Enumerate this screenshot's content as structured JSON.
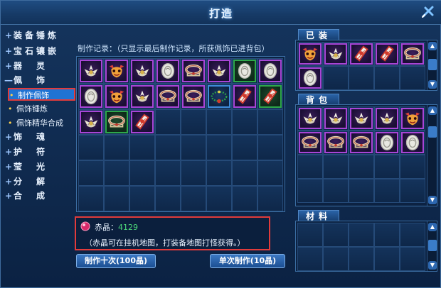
{
  "window": {
    "title": "打造"
  },
  "sidebar": {
    "items": [
      {
        "glyph": "+",
        "label": "装备锤炼"
      },
      {
        "glyph": "+",
        "label": "宝石镶嵌"
      },
      {
        "glyph": "+",
        "label": "器　灵"
      },
      {
        "glyph": "—",
        "label": "佩　饰"
      },
      {
        "glyph": "+",
        "label": "饰　魂"
      },
      {
        "glyph": "+",
        "label": "护　符"
      },
      {
        "glyph": "+",
        "label": "莹　光"
      },
      {
        "glyph": "+",
        "label": "分　解"
      },
      {
        "glyph": "+",
        "label": "合　成"
      }
    ],
    "subitems": [
      {
        "label": "制作佩饰",
        "active": true
      },
      {
        "label": "佩饰锤炼",
        "active": false
      },
      {
        "label": "佩饰精华合成",
        "active": false
      }
    ]
  },
  "record": {
    "label": "制作记录：（只显示最后制作记录，所获佩饰已进背包）"
  },
  "record_items": [
    {
      "icon": "lotus-ornament",
      "border": "purple"
    },
    {
      "icon": "demon-mask",
      "border": "purple"
    },
    {
      "icon": "lotus-ornament",
      "border": "purple"
    },
    {
      "icon": "jade-pendant",
      "border": "purple"
    },
    {
      "icon": "bracelet",
      "border": "purple"
    },
    {
      "icon": "lotus-ornament",
      "border": "purple"
    },
    {
      "icon": "jade-pendant",
      "border": "green"
    },
    {
      "icon": "jade-pendant",
      "border": "purple"
    },
    {
      "icon": "jade-pendant",
      "border": "purple"
    },
    {
      "icon": "demon-mask",
      "border": "purple"
    },
    {
      "icon": "lotus-ornament",
      "border": "purple"
    },
    {
      "icon": "bracelet",
      "border": "purple"
    },
    {
      "icon": "bracelet",
      "border": "purple"
    },
    {
      "icon": "beaded-necklace",
      "border": "blue"
    },
    {
      "icon": "red-talisman",
      "border": "purple"
    },
    {
      "icon": "red-talisman",
      "border": "green"
    },
    {
      "icon": "lotus-ornament",
      "border": "purple"
    },
    {
      "icon": "bracelet",
      "border": "green"
    },
    {
      "icon": "red-talisman",
      "border": "purple"
    }
  ],
  "tabs": {
    "equipped": "已装",
    "bag": "背包",
    "materials": "材料"
  },
  "equipped_items": [
    {
      "icon": "demon-mask",
      "border": "purple"
    },
    {
      "icon": "lotus-ornament",
      "border": "purple"
    },
    {
      "icon": "red-talisman",
      "border": "purple"
    },
    {
      "icon": "red-talisman",
      "border": "purple"
    },
    {
      "icon": "bracelet",
      "border": "purple"
    },
    {
      "icon": "jade-pendant",
      "border": "purple"
    }
  ],
  "bag_items": [
    {
      "icon": "lotus-ornament",
      "border": "purple"
    },
    {
      "icon": "lotus-ornament",
      "border": "purple"
    },
    {
      "icon": "lotus-ornament",
      "border": "purple"
    },
    {
      "icon": "lotus-ornament",
      "border": "purple"
    },
    {
      "icon": "demon-mask",
      "border": "purple"
    },
    {
      "icon": "bracelet",
      "border": "purple"
    },
    {
      "icon": "bracelet",
      "border": "purple"
    },
    {
      "icon": "bracelet",
      "border": "purple"
    },
    {
      "icon": "jade-pendant",
      "border": "purple"
    },
    {
      "icon": "jade-pendant",
      "border": "purple"
    }
  ],
  "info": {
    "currency_label": "赤晶：",
    "currency_value": "4129",
    "hint": "（赤晶可在挂机地图，打装备地图打怪获得。）"
  },
  "buttons": {
    "craft_ten": "制作十次(100晶)",
    "craft_once": "单次制作(10晶)"
  },
  "colors": {
    "purple": "#a845d6",
    "green": "#2ea84a",
    "blue": "#3f8bd9",
    "highlight": "#e23b3b"
  }
}
